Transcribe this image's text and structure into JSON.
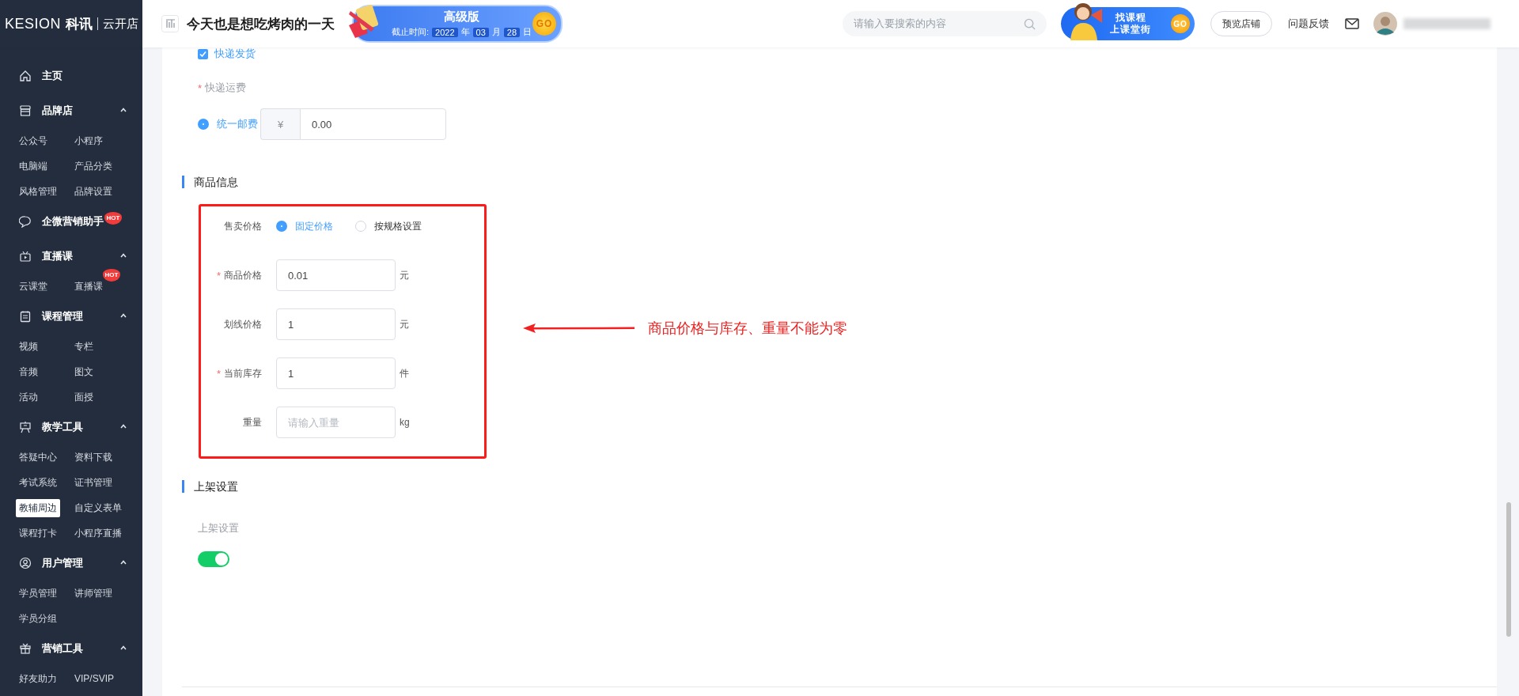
{
  "header": {
    "logo": {
      "brand": "KESION",
      "brand_cn": "科讯",
      "product": "云开店"
    },
    "store_title": "今天也是想吃烤肉的一天",
    "plan_banner": {
      "title": "高级版",
      "deadline_label": "截止时间:",
      "year": "2022",
      "year_unit": "年",
      "month": "03",
      "month_unit": "月",
      "day": "28",
      "day_unit": "日",
      "go": "GO"
    },
    "search": {
      "placeholder": "请输入要搜索的内容"
    },
    "promo_banner": {
      "line1": "找课程",
      "line2": "上课堂街",
      "go": "GO"
    },
    "preview_button": "预览店铺",
    "feedback_link": "问题反馈"
  },
  "sidebar": {
    "groups": [
      {
        "label": "主页",
        "kind": "link"
      },
      {
        "label": "品牌店",
        "kind": "group",
        "expanded": true,
        "items": [
          {
            "label": "公众号",
            "selected": false
          },
          {
            "label": "小程序",
            "selected": false
          },
          {
            "label": "电脑端",
            "selected": false
          },
          {
            "label": "产品分类",
            "selected": false
          },
          {
            "label": "风格管理",
            "selected": false
          },
          {
            "label": "品牌设置",
            "selected": false
          }
        ]
      },
      {
        "label": "企微营销助手",
        "kind": "link",
        "badge": "HOT"
      },
      {
        "label": "直播课",
        "kind": "group",
        "expanded": true,
        "items": [
          {
            "label": "云课堂",
            "selected": false
          },
          {
            "label": "直播课",
            "selected": false,
            "badge": "HOT"
          }
        ]
      },
      {
        "label": "课程管理",
        "kind": "group",
        "expanded": true,
        "items": [
          {
            "label": "视频",
            "selected": false
          },
          {
            "label": "专栏",
            "selected": false
          },
          {
            "label": "音频",
            "selected": false
          },
          {
            "label": "图文",
            "selected": false
          },
          {
            "label": "活动",
            "selected": false
          },
          {
            "label": "面授",
            "selected": false
          }
        ]
      },
      {
        "label": "教学工具",
        "kind": "group",
        "expanded": true,
        "items": [
          {
            "label": "答疑中心",
            "selected": false
          },
          {
            "label": "资料下载",
            "selected": false
          },
          {
            "label": "考试系统",
            "selected": false
          },
          {
            "label": "证书管理",
            "selected": false
          },
          {
            "label": "教辅周边",
            "selected": true
          },
          {
            "label": "自定义表单",
            "selected": false
          },
          {
            "label": "课程打卡",
            "selected": false
          },
          {
            "label": "小程序直播",
            "selected": false
          }
        ]
      },
      {
        "label": "用户管理",
        "kind": "group",
        "expanded": true,
        "items": [
          {
            "label": "学员管理",
            "selected": false
          },
          {
            "label": "讲师管理",
            "selected": false
          },
          {
            "label": "学员分组",
            "selected": false
          }
        ]
      },
      {
        "label": "营销工具",
        "kind": "group",
        "expanded": true,
        "items": [
          {
            "label": "好友助力",
            "selected": false
          },
          {
            "label": "VIP/SVIP",
            "selected": false
          }
        ]
      }
    ]
  },
  "form": {
    "shipping_checkbox": {
      "label": "快递发货",
      "checked": true
    },
    "shipping_fee": {
      "label": "快递运费",
      "required_mark": "*",
      "options": [
        {
          "label": "统一邮费",
          "selected": true
        }
      ],
      "currency": "¥",
      "value": "0.00"
    },
    "product_section": {
      "title": "商品信息",
      "sale_price": {
        "label": "售卖价格",
        "options": [
          {
            "label": "固定价格",
            "selected": true
          },
          {
            "label": "按规格设置",
            "selected": false
          }
        ]
      },
      "fields": [
        {
          "label": "商品价格",
          "required_mark": "*",
          "value": "0.01",
          "unit": "元"
        },
        {
          "label": "划线价格",
          "value": "1",
          "unit": "元"
        },
        {
          "label": "当前库存",
          "required_mark": "*",
          "value": "1",
          "unit": "件"
        },
        {
          "label": "重量",
          "placeholder": "请输入重量",
          "unit": "kg"
        }
      ]
    },
    "annotation": {
      "text": "商品价格与库存、重量不能为零"
    },
    "listing_section": {
      "title": "上架设置",
      "field_label": "上架设置",
      "toggle": {
        "on": true
      }
    }
  }
}
